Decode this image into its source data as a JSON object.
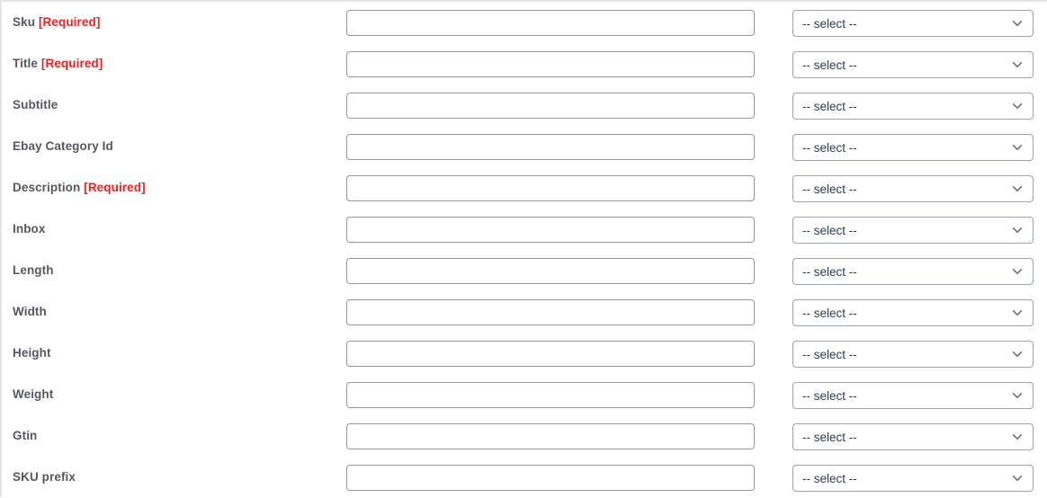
{
  "form": {
    "required_marker": "[Required]",
    "select_placeholder": "-- select --",
    "chevron_icon": "chevron-down-icon",
    "colors": {
      "label_text": "#54595f",
      "required_text": "#ef2121",
      "input_border": "#8e97a4",
      "select_border": "#9aa2ad",
      "select_text": "#2c3e50",
      "background": "#ffffff",
      "container_border": "#e2e4e6"
    },
    "rows": [
      {
        "label": "Sku",
        "required": "[Required]",
        "input_value": "",
        "select_value": "-- select --"
      },
      {
        "label": "Title",
        "required": "[Required]",
        "input_value": "",
        "select_value": "-- select --"
      },
      {
        "label": "Subtitle",
        "required": "",
        "input_value": "",
        "select_value": "-- select --"
      },
      {
        "label": "Ebay Category Id",
        "required": "",
        "input_value": "",
        "select_value": "-- select --"
      },
      {
        "label": "Description",
        "required": "[Required]",
        "input_value": "",
        "select_value": "-- select --"
      },
      {
        "label": "Inbox",
        "required": "",
        "input_value": "",
        "select_value": "-- select --"
      },
      {
        "label": "Length",
        "required": "",
        "input_value": "",
        "select_value": "-- select --"
      },
      {
        "label": "Width",
        "required": "",
        "input_value": "",
        "select_value": "-- select --"
      },
      {
        "label": "Height",
        "required": "",
        "input_value": "",
        "select_value": "-- select --"
      },
      {
        "label": "Weight",
        "required": "",
        "input_value": "",
        "select_value": "-- select --"
      },
      {
        "label": "Gtin",
        "required": "",
        "input_value": "",
        "select_value": "-- select --"
      },
      {
        "label": "SKU prefix",
        "required": "",
        "input_value": "",
        "select_value": "-- select --"
      }
    ]
  }
}
